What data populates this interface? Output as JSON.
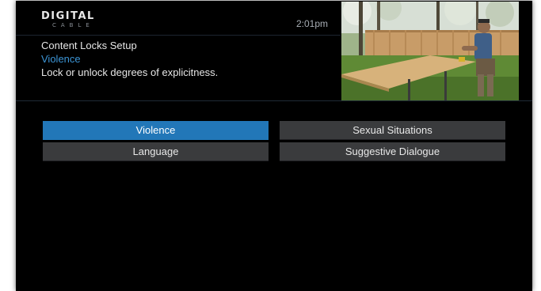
{
  "header": {
    "logo_main": "DIGITAL",
    "logo_sub": "CABLE",
    "clock": "2:01pm",
    "title": "Content Locks Setup",
    "subtitle": "Violence",
    "description": "Lock or unlock degrees of explicitness."
  },
  "menu": {
    "items": [
      {
        "label": "Violence",
        "selected": true
      },
      {
        "label": "Sexual Situations",
        "selected": false
      },
      {
        "label": "Language",
        "selected": false
      },
      {
        "label": "Suggestive Dialogue",
        "selected": false
      }
    ]
  },
  "colors": {
    "accent": "#2277b8",
    "accent_text": "#3c95d6",
    "button_bg": "#3a3b3d",
    "screen_bg": "#000000"
  },
  "icons": {
    "logo": "digital-cable-logo",
    "preview": "video-preview-thumbnail"
  }
}
